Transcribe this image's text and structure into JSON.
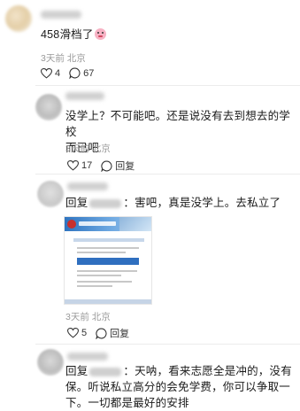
{
  "comments": [
    {
      "text": "458滑档了",
      "meta": "3天前 北京",
      "likes": "4",
      "replies": "67"
    },
    {
      "text_line1": "没学上？不可能吧。还是说没有去到想去的学校",
      "text_line2": "而已吧",
      "meta": "3天前 北京",
      "likes": "17",
      "reply_label": "回复"
    },
    {
      "reply_prefix": "回复",
      "text": "：害吧，真是没学上。去私立了",
      "meta": "3天前 北京",
      "likes": "5",
      "reply_label": "回复"
    },
    {
      "reply_prefix": "回复",
      "text_line1": "：天呐，看来志愿全是冲的，没有",
      "text_line2": "保。听说私立高分的会免学费，你可以争取一",
      "text_line3": "下。一切都是最好的安排"
    }
  ],
  "icons": {
    "like": "heart-outline-icon",
    "reply": "speech-bubble-icon",
    "emoji": "pig-face-emoji"
  }
}
